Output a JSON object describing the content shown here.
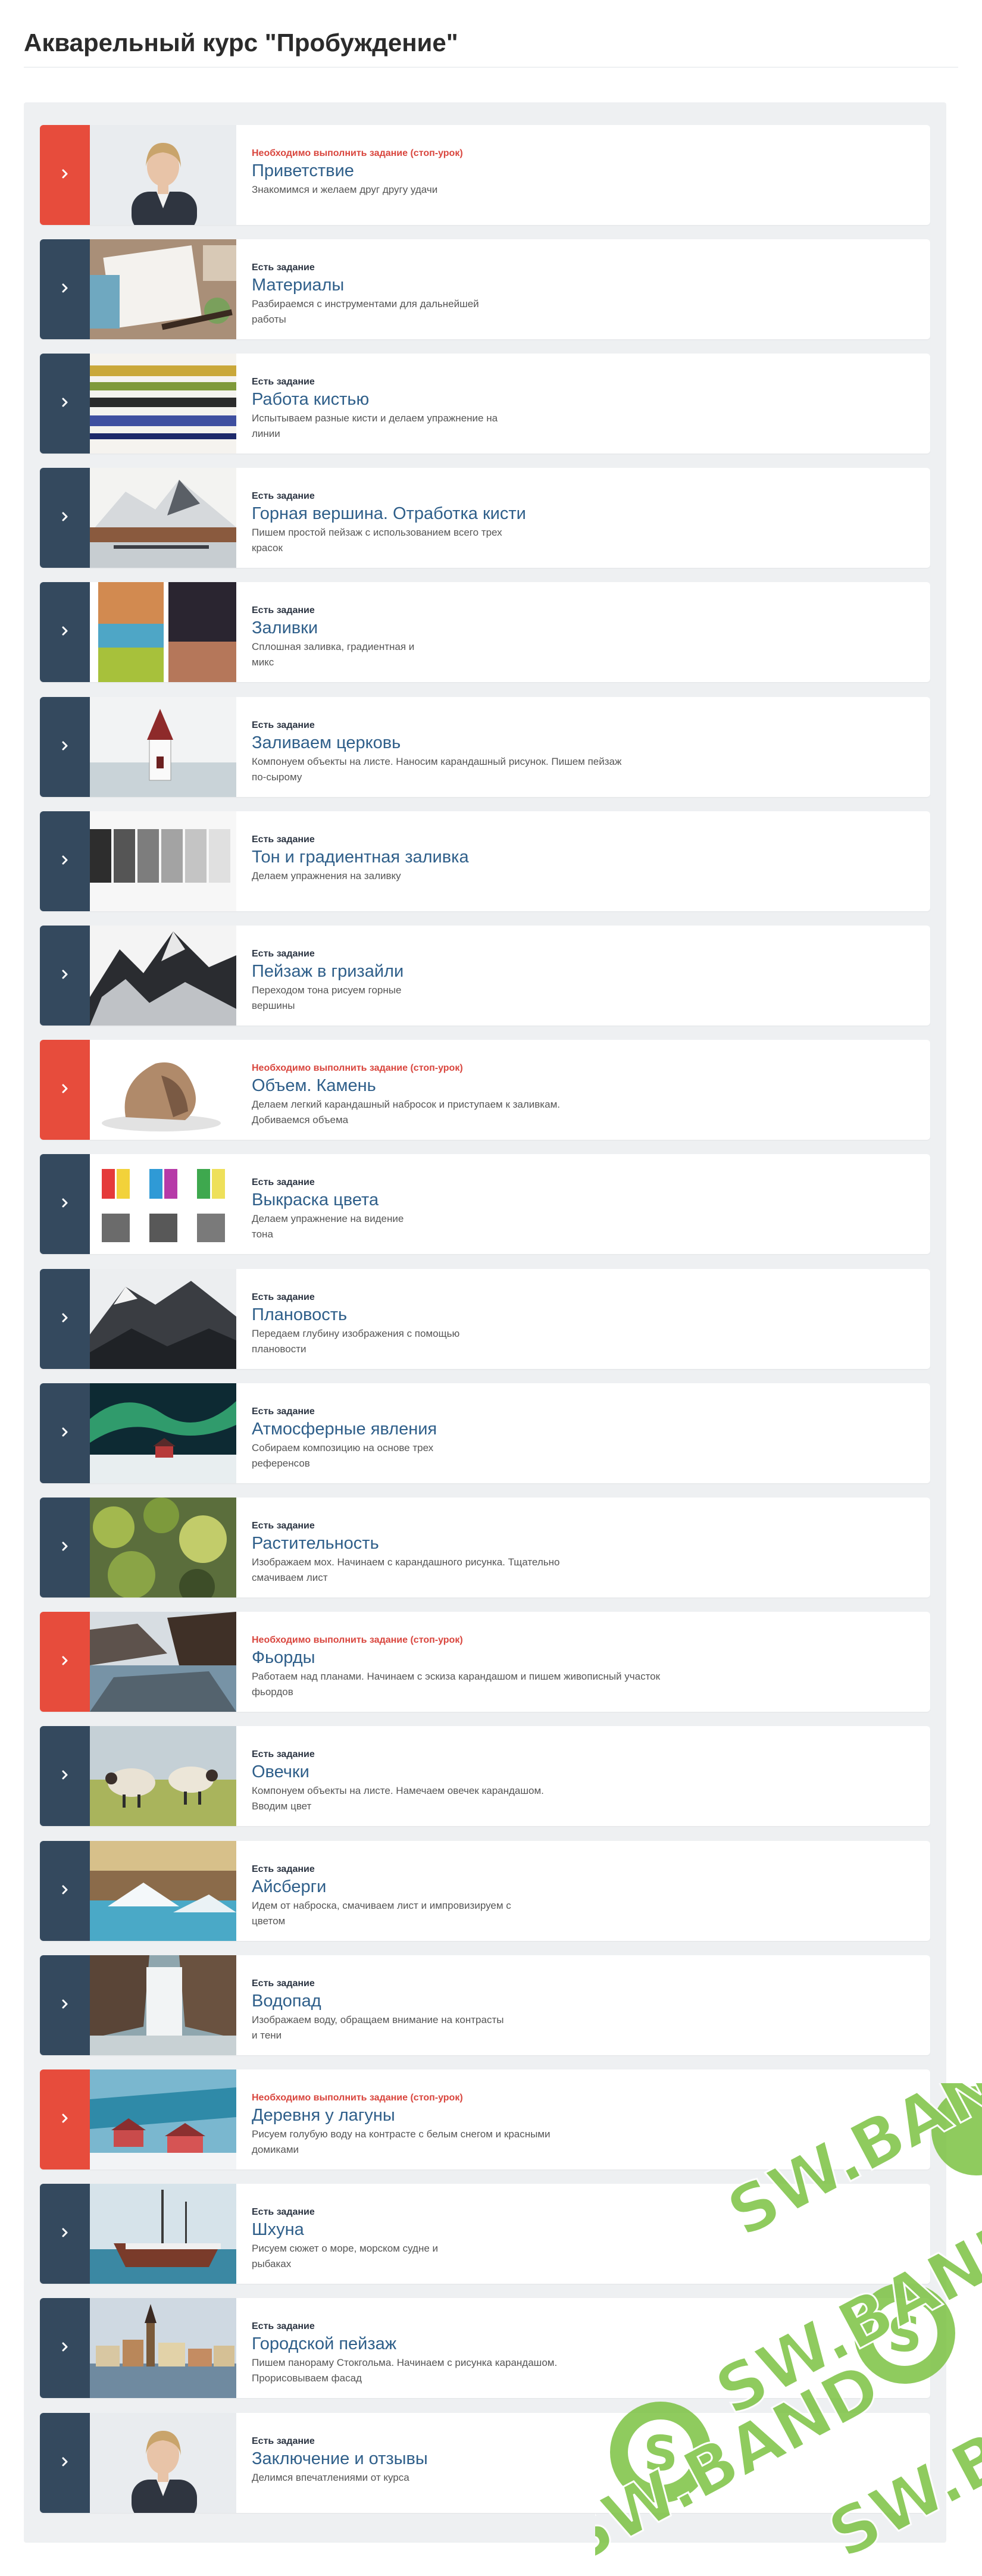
{
  "page": {
    "title": "Акварельный курс \"Пробуждение\""
  },
  "colors": {
    "done": "#34495e",
    "stop": "#e74c3c",
    "title": "#2f5f8a"
  },
  "watermark": {
    "text": "SW.BAND"
  },
  "lessons": [
    {
      "status": "Необходимо выполнить задание (стоп-урок)",
      "kind": "stop",
      "title": "Приветствие",
      "desc": "Знакомимся и желаем друг другу удачи",
      "thumb": "portrait"
    },
    {
      "status": "Есть задание",
      "kind": "done",
      "title": "Материалы",
      "desc": "Разбираемся с инструментами для дальнейшей\nработы",
      "thumb": "materials"
    },
    {
      "status": "Есть задание",
      "kind": "done",
      "title": "Работа кистью",
      "desc": "Испытываем разные кисти и делаем упражнение на\nлинии",
      "thumb": "strokes"
    },
    {
      "status": "Есть задание",
      "kind": "done",
      "title": "Горная вершина. Отработка кисти",
      "desc": "Пишем простой пейзаж с использованием всего трех\nкрасок",
      "thumb": "mountain"
    },
    {
      "status": "Есть задание",
      "kind": "done",
      "title": "Заливки",
      "desc": "Сплошная заливка, градиентная и\nмикс",
      "thumb": "fills"
    },
    {
      "status": "Есть задание",
      "kind": "done",
      "title": "Заливаем церковь",
      "desc": "Компонуем объекты на листе. Наносим карандашный рисунок. Пишем пейзаж\nпо-сырому",
      "thumb": "church"
    },
    {
      "status": "Есть задание",
      "kind": "done",
      "title": "Тон и градиентная заливка",
      "desc": "Делаем упражнения на заливку",
      "thumb": "tones"
    },
    {
      "status": "Есть задание",
      "kind": "done",
      "title": "Пейзаж в гризайли",
      "desc": "Переходом тона рисуем горные\nвершины",
      "thumb": "grisaille"
    },
    {
      "status": "Необходимо выполнить задание (стоп-урок)",
      "kind": "stop",
      "title": "Объем. Камень",
      "desc": "Делаем легкий карандашный набросок и приступаем к заливкам.\nДобиваемся объема",
      "thumb": "stone"
    },
    {
      "status": "Есть задание",
      "kind": "done",
      "title": "Выкраска цвета",
      "desc": "Делаем упражнение на видение\nтона",
      "thumb": "swatches"
    },
    {
      "status": "Есть задание",
      "kind": "done",
      "title": "Плановость",
      "desc": "Передаем глубину изображения с помощью\nплановости",
      "thumb": "planes"
    },
    {
      "status": "Есть задание",
      "kind": "done",
      "title": "Атмосферные явления",
      "desc": "Собираем композицию на основе трех\nреференсов",
      "thumb": "aurora"
    },
    {
      "status": "Есть задание",
      "kind": "done",
      "title": "Растительность",
      "desc": "Изображаем мох. Начинаем с карандашного рисунка. Тщательно\nсмачиваем лист",
      "thumb": "moss"
    },
    {
      "status": "Необходимо выполнить задание (стоп-урок)",
      "kind": "stop",
      "title": "Фьорды",
      "desc": "Работаем над планами. Начинаем с эскиза карандашом и пишем живописный участок\nфьордов",
      "thumb": "fjord"
    },
    {
      "status": "Есть задание",
      "kind": "done",
      "title": "Овечки",
      "desc": "Компонуем объекты на листе. Намечаем овечек карандашом.\nВводим цвет",
      "thumb": "sheep"
    },
    {
      "status": "Есть задание",
      "kind": "done",
      "title": "Айсберги",
      "desc": "Идем от наброска, смачиваем лист и импровизируем с\nцветом",
      "thumb": "iceberg"
    },
    {
      "status": "Есть задание",
      "kind": "done",
      "title": "Водопад",
      "desc": "Изображаем воду, обращаем внимание на контрасты\nи тени",
      "thumb": "waterfall"
    },
    {
      "status": "Необходимо выполнить задание (стоп-урок)",
      "kind": "stop",
      "title": "Деревня у лагуны",
      "desc": "Рисуем голубую воду на контрасте с белым снегом и красными\nдомиками",
      "thumb": "village"
    },
    {
      "status": "Есть задание",
      "kind": "done",
      "title": "Шхуна",
      "desc": "Рисуем сюжет о море, морском судне и\nрыбаках",
      "thumb": "schooner"
    },
    {
      "status": "Есть задание",
      "kind": "done",
      "title": "Городской пейзаж",
      "desc": "Пишем панораму Стокгольма. Начинаем с рисунка карандашом.\nПрорисовываем фасад",
      "thumb": "city"
    },
    {
      "status": "Есть задание",
      "kind": "done",
      "title": "Заключение и отзывы",
      "desc": "Делимся впечатлениями от курса",
      "thumb": "portrait"
    }
  ]
}
